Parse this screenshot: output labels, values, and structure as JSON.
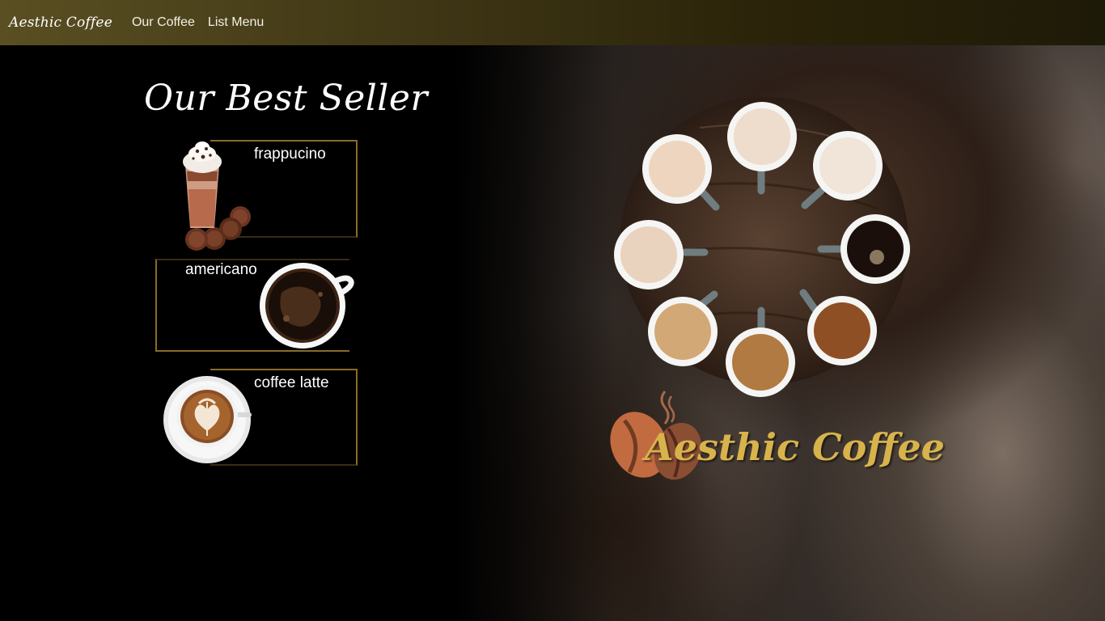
{
  "navbar": {
    "brand": "Aesthic Coffee",
    "links": [
      "Our Coffee",
      "List Menu"
    ]
  },
  "best_seller": {
    "title": "Our Best Seller",
    "items": [
      {
        "name": "frappucino",
        "image": "frappuccino-glass-with-cookies"
      },
      {
        "name": "americano",
        "image": "black-coffee-cup"
      },
      {
        "name": "coffee latte",
        "image": "latte-art-cup"
      }
    ]
  },
  "hero": {
    "image": "coffee-cups-on-round-wooden-board",
    "logo_text": "Aesthic Coffee",
    "logo_icon": "coffee-bean-steam-logo"
  },
  "colors": {
    "navbar_left": "#5a4f22",
    "navbar_right": "#1e1a08",
    "card_border": "#8a6a2c",
    "logo_gold": "#d8b34c"
  }
}
